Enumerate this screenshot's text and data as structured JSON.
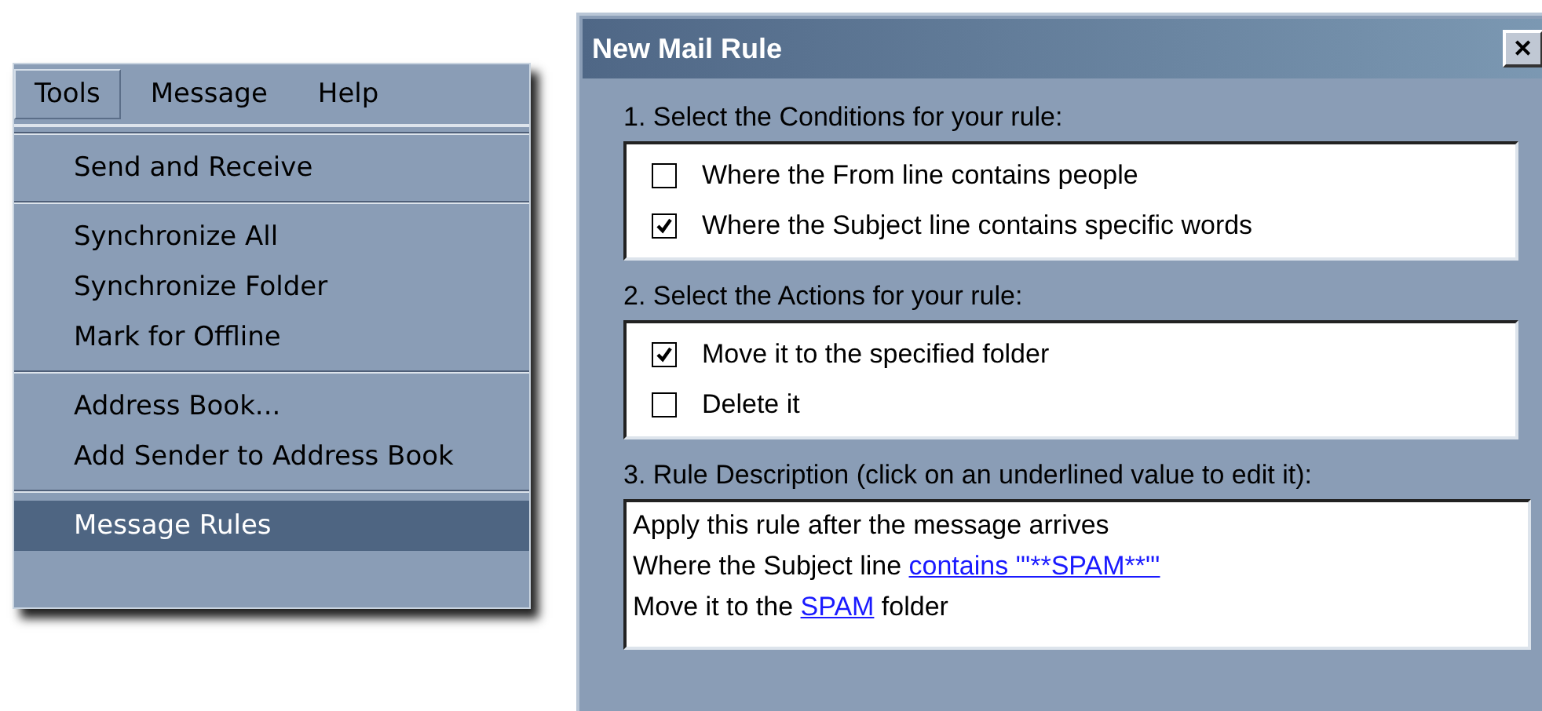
{
  "menu_bar": [
    {
      "label": "Tools",
      "selected": true
    },
    {
      "label": "Message",
      "selected": false
    },
    {
      "label": "Help",
      "selected": false
    }
  ],
  "menu_groups": [
    [
      {
        "label": "Send and Receive",
        "selected": false
      }
    ],
    [
      {
        "label": "Synchronize All",
        "selected": false
      },
      {
        "label": "Synchronize Folder",
        "selected": false
      },
      {
        "label": "Mark for Offline",
        "selected": false
      }
    ],
    [
      {
        "label": "Address Book...",
        "selected": false
      },
      {
        "label": "Add Sender to Address Book",
        "selected": false
      }
    ],
    [
      {
        "label": "Message Rules",
        "selected": true
      }
    ]
  ],
  "dialog": {
    "title": "New Mail Rule",
    "close": "✕",
    "conditions": {
      "label": "1. Select the Conditions for your rule:",
      "items": [
        {
          "label": "Where the From line contains people",
          "checked": false
        },
        {
          "label": "Where the Subject line contains specific words",
          "checked": true
        }
      ]
    },
    "actions": {
      "label": "2. Select the Actions for your rule:",
      "items": [
        {
          "label": "Move it to the specified folder",
          "checked": true
        },
        {
          "label": "Delete it",
          "checked": false
        }
      ]
    },
    "description": {
      "label": "3. Rule Description (click on an underlined value to edit it):",
      "lines": [
        [
          {
            "kind": "plain",
            "text": "Apply this rule after the message arrives"
          }
        ],
        [
          {
            "kind": "plain",
            "text": "Where the Subject line "
          },
          {
            "kind": "link",
            "text": "contains '\"**SPAM**\"'"
          }
        ],
        [
          {
            "kind": "plain",
            "text": "Move it to the "
          },
          {
            "kind": "link",
            "text": "SPAM"
          },
          {
            "kind": "plain",
            "text": " folder"
          }
        ]
      ]
    }
  }
}
